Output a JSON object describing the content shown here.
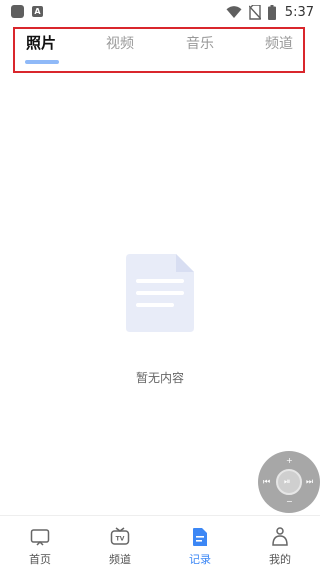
{
  "status_bar": {
    "time": "5:37",
    "left_icons": [
      "app-icon",
      "a-icon"
    ],
    "right_icons": [
      "wifi-icon",
      "no-sim-icon",
      "battery-icon"
    ]
  },
  "tabs": [
    {
      "label": "照片",
      "active": true
    },
    {
      "label": "视频",
      "active": false
    },
    {
      "label": "音乐",
      "active": false
    },
    {
      "label": "频道",
      "active": false
    }
  ],
  "empty_state": {
    "icon": "document-icon",
    "text": "暂无内容"
  },
  "remote": {
    "icon": "remote-control-icon",
    "glyphs": {
      "up": "+",
      "down": "−",
      "left": "⏮",
      "right": "⏭",
      "center": "⏯"
    }
  },
  "bottom_nav": [
    {
      "label": "首页",
      "icon": "tv-screen-icon",
      "active": false
    },
    {
      "label": "频道",
      "icon": "tv-channel-icon",
      "active": false
    },
    {
      "label": "记录",
      "icon": "record-document-icon",
      "active": true
    },
    {
      "label": "我的",
      "icon": "profile-icon",
      "active": false
    }
  ],
  "colors": {
    "accent": "#3c87f5",
    "tab_indicator": "#8fb9f8",
    "highlight_box": "#d9262c",
    "illustration": "#e8ecf8"
  }
}
